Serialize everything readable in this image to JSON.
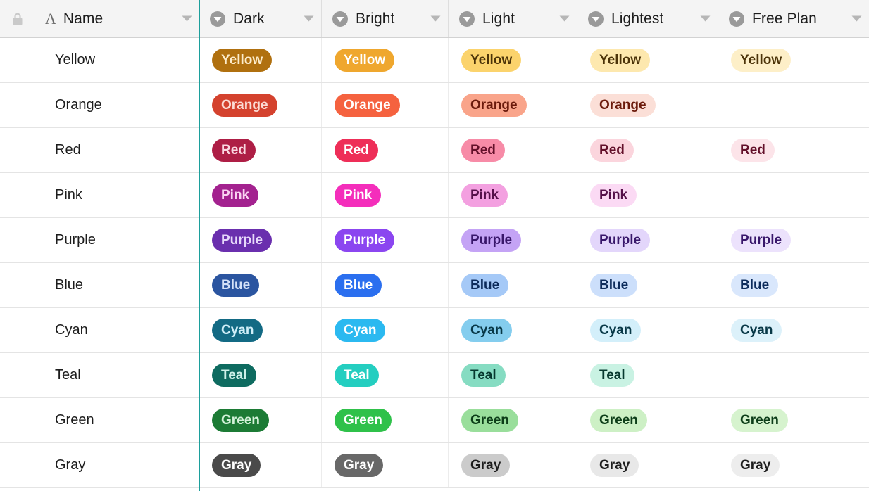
{
  "grid": {
    "freeze_divider_color": "#1c9f9c",
    "header_background": "#f4f4f4",
    "row_border_color": "#e4e4e4"
  },
  "header": {
    "lock_icon": "lock-icon",
    "columns": [
      {
        "label": "Name",
        "icon": "text-field-icon",
        "icon_name": "A",
        "caret": "chevron-down-icon"
      },
      {
        "label": "Dark",
        "icon": "single-select-field-icon",
        "caret": "chevron-down-icon"
      },
      {
        "label": "Bright",
        "icon": "single-select-field-icon",
        "caret": "chevron-down-icon"
      },
      {
        "label": "Light",
        "icon": "single-select-field-icon",
        "caret": "chevron-down-icon"
      },
      {
        "label": "Lightest",
        "icon": "single-select-field-icon",
        "caret": "chevron-down-icon"
      },
      {
        "label": "Free Plan",
        "icon": "single-select-field-icon",
        "caret": "chevron-down-icon"
      }
    ]
  },
  "rows": [
    {
      "name": "Yellow",
      "cells": [
        {
          "label": "Yellow",
          "bg": "#b0700f",
          "fg": "#fdeccb"
        },
        {
          "label": "Yellow",
          "bg": "#efa72e",
          "fg": "#ffffff"
        },
        {
          "label": "Yellow",
          "bg": "#fbd36c",
          "fg": "#4b3309"
        },
        {
          "label": "Yellow",
          "bg": "#fde8ae",
          "fg": "#4b3309"
        },
        {
          "label": "Yellow",
          "bg": "#fdefc8",
          "fg": "#4b3309"
        }
      ]
    },
    {
      "name": "Orange",
      "cells": [
        {
          "label": "Orange",
          "bg": "#d4422e",
          "fg": "#fbdcd5"
        },
        {
          "label": "Orange",
          "bg": "#f5623f",
          "fg": "#ffffff"
        },
        {
          "label": "Orange",
          "bg": "#f9a48a",
          "fg": "#6b1a0b"
        },
        {
          "label": "Orange",
          "bg": "#fbdfd7",
          "fg": "#6b1a0b"
        },
        {
          "label": "",
          "bg": "",
          "fg": ""
        }
      ]
    },
    {
      "name": "Red",
      "cells": [
        {
          "label": "Red",
          "bg": "#ae1e45",
          "fg": "#fbd8e1"
        },
        {
          "label": "Red",
          "bg": "#ee2e58",
          "fg": "#ffffff"
        },
        {
          "label": "Red",
          "bg": "#f78ba7",
          "fg": "#63102a"
        },
        {
          "label": "Red",
          "bg": "#fbd5dd",
          "fg": "#63102a"
        },
        {
          "label": "Red",
          "bg": "#fce4e9",
          "fg": "#63102a"
        }
      ]
    },
    {
      "name": "Pink",
      "cells": [
        {
          "label": "Pink",
          "bg": "#a3228f",
          "fg": "#fad4f2"
        },
        {
          "label": "Pink",
          "bg": "#f42ebb",
          "fg": "#ffffff"
        },
        {
          "label": "Pink",
          "bg": "#f3a0e0",
          "fg": "#551049"
        },
        {
          "label": "Pink",
          "bg": "#fbdaf4",
          "fg": "#551049"
        },
        {
          "label": "",
          "bg": "",
          "fg": ""
        }
      ]
    },
    {
      "name": "Purple",
      "cells": [
        {
          "label": "Purple",
          "bg": "#6a2fae",
          "fg": "#e6d8fa"
        },
        {
          "label": "Purple",
          "bg": "#8b46f0",
          "fg": "#ffffff"
        },
        {
          "label": "Purple",
          "bg": "#c4a3f5",
          "fg": "#39176b"
        },
        {
          "label": "Purple",
          "bg": "#e3d6fb",
          "fg": "#39176b"
        },
        {
          "label": "Purple",
          "bg": "#ece2fc",
          "fg": "#39176b"
        }
      ]
    },
    {
      "name": "Blue",
      "cells": [
        {
          "label": "Blue",
          "bg": "#2b55a0",
          "fg": "#d5e2f8"
        },
        {
          "label": "Blue",
          "bg": "#2b6fef",
          "fg": "#ffffff"
        },
        {
          "label": "Blue",
          "bg": "#a5c9f7",
          "fg": "#0d2c5c"
        },
        {
          "label": "Blue",
          "bg": "#ccdffb",
          "fg": "#0d2c5c"
        },
        {
          "label": "Blue",
          "bg": "#d9e7fc",
          "fg": "#0d2c5c"
        }
      ]
    },
    {
      "name": "Cyan",
      "cells": [
        {
          "label": "Cyan",
          "bg": "#136a84",
          "fg": "#d0eef8"
        },
        {
          "label": "Cyan",
          "bg": "#2bb9f0",
          "fg": "#ffffff"
        },
        {
          "label": "Cyan",
          "bg": "#84cdee",
          "fg": "#083847"
        },
        {
          "label": "Cyan",
          "bg": "#d3effa",
          "fg": "#083847"
        },
        {
          "label": "Cyan",
          "bg": "#dcf1fa",
          "fg": "#083847"
        }
      ]
    },
    {
      "name": "Teal",
      "cells": [
        {
          "label": "Teal",
          "bg": "#0e6b60",
          "fg": "#cdf1e9"
        },
        {
          "label": "Teal",
          "bg": "#24cec0",
          "fg": "#ffffff"
        },
        {
          "label": "Teal",
          "bg": "#86dcc2",
          "fg": "#07392f"
        },
        {
          "label": "Teal",
          "bg": "#c9f2e3",
          "fg": "#07392f"
        },
        {
          "label": "",
          "bg": "",
          "fg": ""
        }
      ]
    },
    {
      "name": "Green",
      "cells": [
        {
          "label": "Green",
          "bg": "#1c7b35",
          "fg": "#d4f2da"
        },
        {
          "label": "Green",
          "bg": "#2fc14a",
          "fg": "#ffffff"
        },
        {
          "label": "Green",
          "bg": "#99de9b",
          "fg": "#0c3d18"
        },
        {
          "label": "Green",
          "bg": "#cdf0c5",
          "fg": "#0c3d18"
        },
        {
          "label": "Green",
          "bg": "#d6f3ce",
          "fg": "#0c3d18"
        }
      ]
    },
    {
      "name": "Gray",
      "cells": [
        {
          "label": "Gray",
          "bg": "#4a4a4a",
          "fg": "#ffffff"
        },
        {
          "label": "Gray",
          "bg": "#686868",
          "fg": "#ffffff"
        },
        {
          "label": "Gray",
          "bg": "#cbcbcb",
          "fg": "#1d1d1d"
        },
        {
          "label": "Gray",
          "bg": "#e8e8e8",
          "fg": "#1d1d1d"
        },
        {
          "label": "Gray",
          "bg": "#ededed",
          "fg": "#1d1d1d"
        }
      ]
    }
  ]
}
